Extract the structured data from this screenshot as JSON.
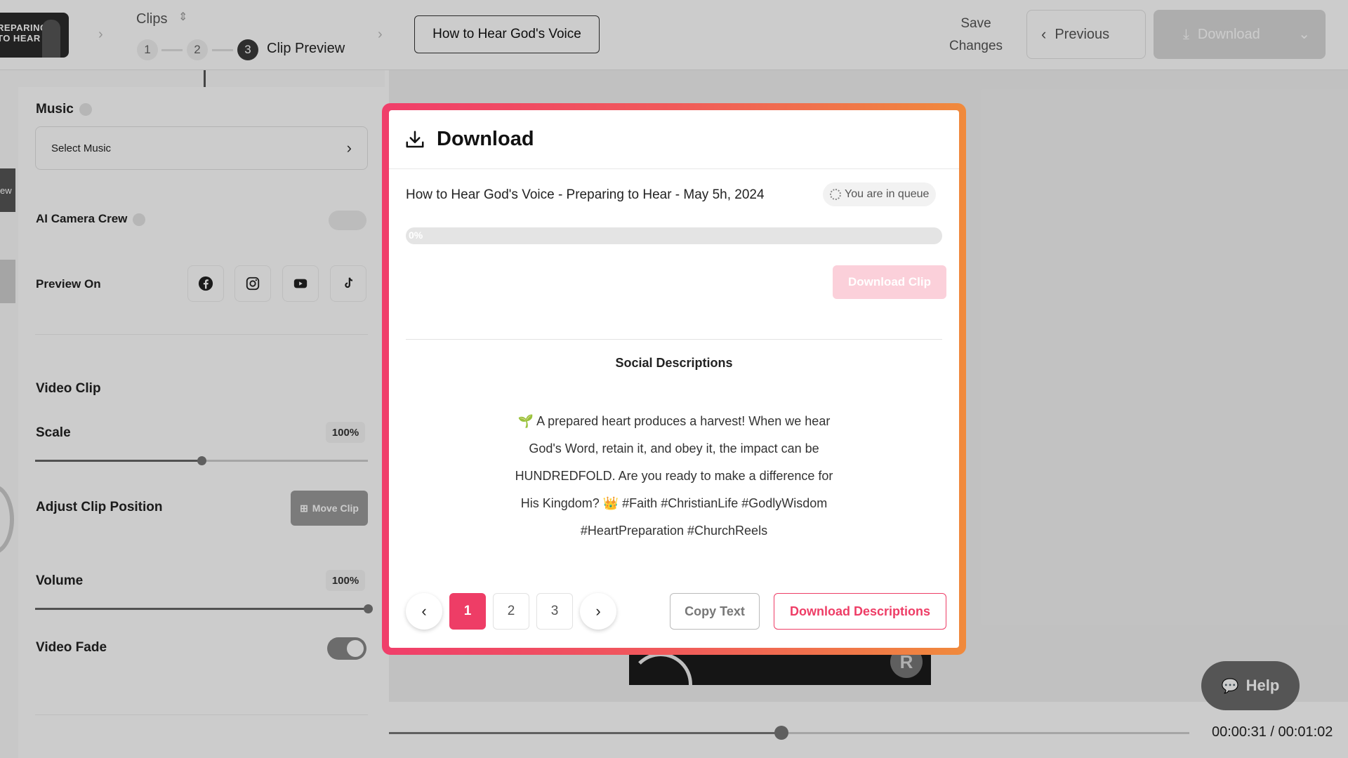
{
  "topbar": {
    "thumb_text_line1": "REPARING",
    "thumb_text_line2": "TO HEAR",
    "clips_label": "Clips",
    "steps": [
      "1",
      "2",
      "3"
    ],
    "active_step_label": "Clip Preview",
    "project_title": "How to Hear God's Voice",
    "save_label_line1": "Save",
    "save_label_line2": "Changes",
    "previous_label": "Previous",
    "download_label": "Download"
  },
  "left_panel": {
    "edge_tab_text": "ew",
    "music_label": "Music",
    "music_select_placeholder": "Select Music",
    "ai_camera_label": "AI Camera Crew",
    "preview_on_label": "Preview On",
    "social_platforms": [
      "facebook-icon",
      "instagram-icon",
      "youtube-icon",
      "tiktok-icon"
    ],
    "video_clip_label": "Video Clip",
    "scale_label": "Scale",
    "scale_value": "100%",
    "scale_slider_fraction": 0.5,
    "adjust_label": "Adjust Clip Position",
    "move_clip_label": "Move Clip",
    "volume_label": "Volume",
    "volume_value": "100%",
    "volume_slider_fraction": 1.0,
    "video_fade_label": "Video Fade",
    "video_fade_on": true
  },
  "player": {
    "timecode": "00:00:31 / 00:01:02",
    "progress_fraction": 0.49,
    "help_label": "Help",
    "logo_letter": "R"
  },
  "modal": {
    "title": "Download",
    "clip_name": "How to Hear God's Voice - Preparing to Hear - May 5h, 2024",
    "queue_status": "You are in queue",
    "progress_text": "0%",
    "progress_fraction": 0.0,
    "download_clip_label": "Download Clip",
    "social_title": "Social Descriptions",
    "description": "🌱 A prepared heart produces a harvest! When we hear God's Word, retain it, and obey it, the impact can be HUNDREDFOLD. Are you ready to make a difference for His Kingdom? 👑 #Faith #ChristianLife #GodlyWisdom #HeartPreparation #ChurchReels",
    "pages": [
      "1",
      "2",
      "3"
    ],
    "active_page": "1",
    "copy_label": "Copy Text",
    "download_desc_label": "Download Descriptions"
  },
  "colors": {
    "accent": "#ee3d66",
    "gradient_start": "#f03e6a",
    "gradient_end": "#f08a3c"
  }
}
